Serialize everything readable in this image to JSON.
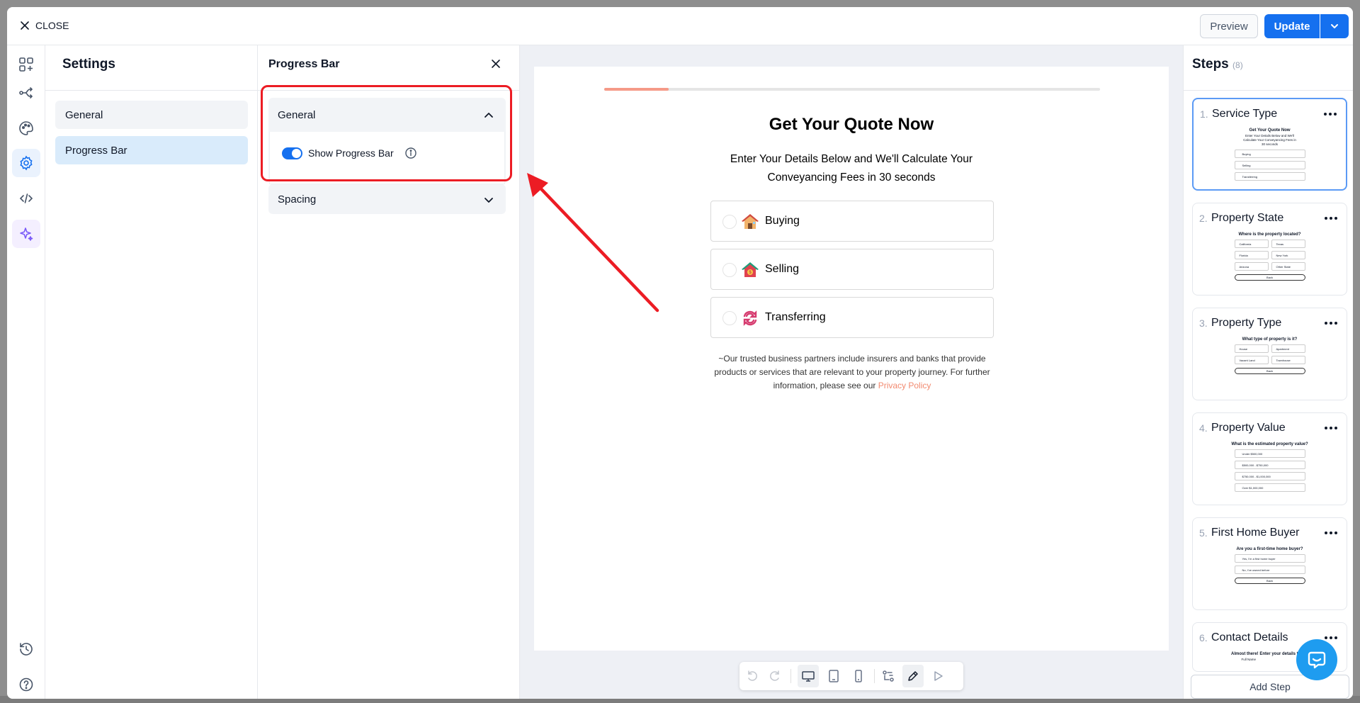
{
  "topbar": {
    "close_label": "CLOSE",
    "preview_label": "Preview",
    "update_label": "Update"
  },
  "rail": {
    "icons": [
      "add-element-icon",
      "flow-icon",
      "palette-icon",
      "settings-icon",
      "code-icon",
      "sparkle-icon",
      "history-icon",
      "help-icon"
    ]
  },
  "settings": {
    "title": "Settings",
    "nav": [
      {
        "label": "General"
      },
      {
        "label": "Progress Bar"
      }
    ]
  },
  "progress_panel": {
    "title": "Progress Bar",
    "general_section": {
      "label": "General",
      "toggle_label": "Show Progress Bar",
      "toggle_on": true
    },
    "spacing_section": {
      "label": "Spacing"
    }
  },
  "form": {
    "progress_fraction": 0.13,
    "title": "Get Your Quote Now",
    "subtitle": "Enter Your Details Below and We'll Calculate Your Conveyancing Fees in 30 seconds",
    "options": [
      {
        "label": "Buying"
      },
      {
        "label": "Selling"
      },
      {
        "label": "Transferring"
      }
    ],
    "disclaimer": "~Our trusted business partners include insurers and banks that provide products or services that are relevant to your property journey. For further information, please see our",
    "privacy_link": "Privacy Policy"
  },
  "steps": {
    "title": "Steps",
    "count": "(8)",
    "items": [
      {
        "num": "1.",
        "name": "Service Type",
        "thumb_title": "Get Your Quote Now",
        "thumb_sub": "Enter Your Details Below and We'll Calculate Your Conveyancing Fees in 30 seconds",
        "thumb_opts": [
          "Buying",
          "Selling",
          "Transferring"
        ]
      },
      {
        "num": "2.",
        "name": "Property State",
        "thumb_title": "Where is the property located?",
        "thumb_cells": [
          "California",
          "Texas",
          "Florida",
          "New York",
          "Arizona",
          "Other State"
        ],
        "thumb_back": "Back"
      },
      {
        "num": "3.",
        "name": "Property Type",
        "thumb_title": "What type of property is it?",
        "thumb_cells": [
          "House",
          "Apartment",
          "Vacant Land",
          "Townhouse"
        ],
        "thumb_back": "Back"
      },
      {
        "num": "4.",
        "name": "Property Value",
        "thumb_title": "What is the estimated property value?",
        "thumb_opts": [
          "Under $500,000",
          "$500,000 - $750,000",
          "$750,000 - $1,000,000",
          "Over $1,000,000"
        ]
      },
      {
        "num": "5.",
        "name": "First Home Buyer",
        "thumb_title": "Are you a first-time home buyer?",
        "thumb_opts": [
          "Yes, I'm a first home buyer",
          "No, I've owned before"
        ],
        "thumb_back": "Back"
      },
      {
        "num": "6.",
        "name": "Contact Details",
        "thumb_title": "Almost there! Enter your details to get",
        "thumb_sub": "Full Name"
      }
    ],
    "add_label": "Add Step"
  }
}
